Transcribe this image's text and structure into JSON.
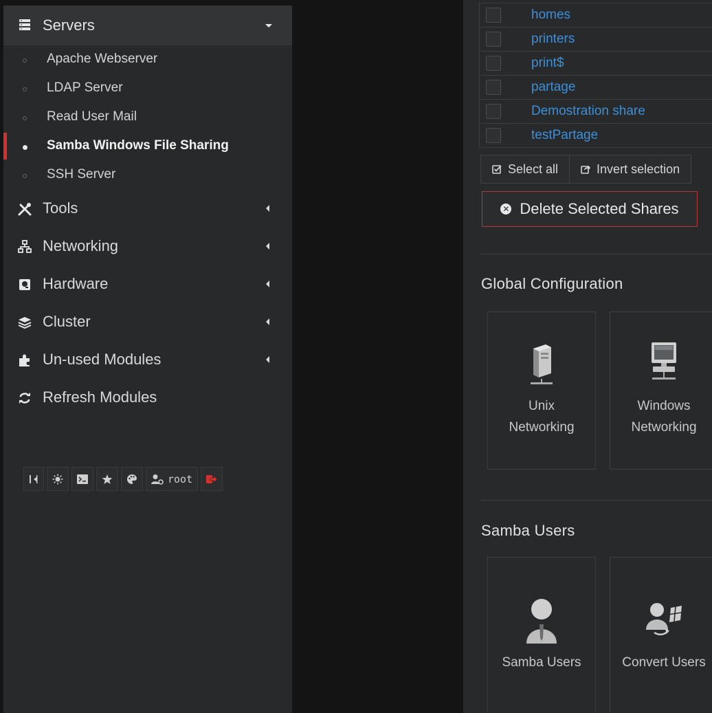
{
  "sidebar": {
    "category": "Servers",
    "sub_items": [
      {
        "label": "Apache Webserver",
        "active": false
      },
      {
        "label": "LDAP Server",
        "active": false
      },
      {
        "label": "Read User Mail",
        "active": false
      },
      {
        "label": "Samba Windows File Sharing",
        "active": true
      },
      {
        "label": "SSH Server",
        "active": false
      }
    ],
    "nav_items": [
      {
        "label": "Tools",
        "icon": "tools-icon"
      },
      {
        "label": "Networking",
        "icon": "network-icon"
      },
      {
        "label": "Hardware",
        "icon": "hardware-icon"
      },
      {
        "label": "Cluster",
        "icon": "cluster-icon"
      },
      {
        "label": "Un-used Modules",
        "icon": "puzzle-icon"
      },
      {
        "label": "Refresh Modules",
        "icon": "refresh-icon"
      }
    ],
    "toolbar": {
      "user": "root"
    }
  },
  "main": {
    "shares": [
      "homes",
      "printers",
      "print$",
      "partage",
      "Demostration share",
      "testPartage"
    ],
    "select_all_label": "Select all",
    "invert_selection_label": "Invert selection",
    "delete_label": "Delete Selected Shares",
    "global_config": {
      "title": "Global Configuration",
      "cards": [
        {
          "line1": "Unix",
          "line2": "Networking"
        },
        {
          "line1": "Windows",
          "line2": "Networking"
        }
      ]
    },
    "samba_users": {
      "title": "Samba Users",
      "cards": [
        {
          "label": "Samba Users"
        },
        {
          "label": "Convert Users"
        }
      ]
    }
  },
  "colors": {
    "accent_red": "#d62f2f",
    "link_blue": "#3d8fd8",
    "sidebar_bg": "#27292b",
    "panel_bg": "#141414"
  }
}
